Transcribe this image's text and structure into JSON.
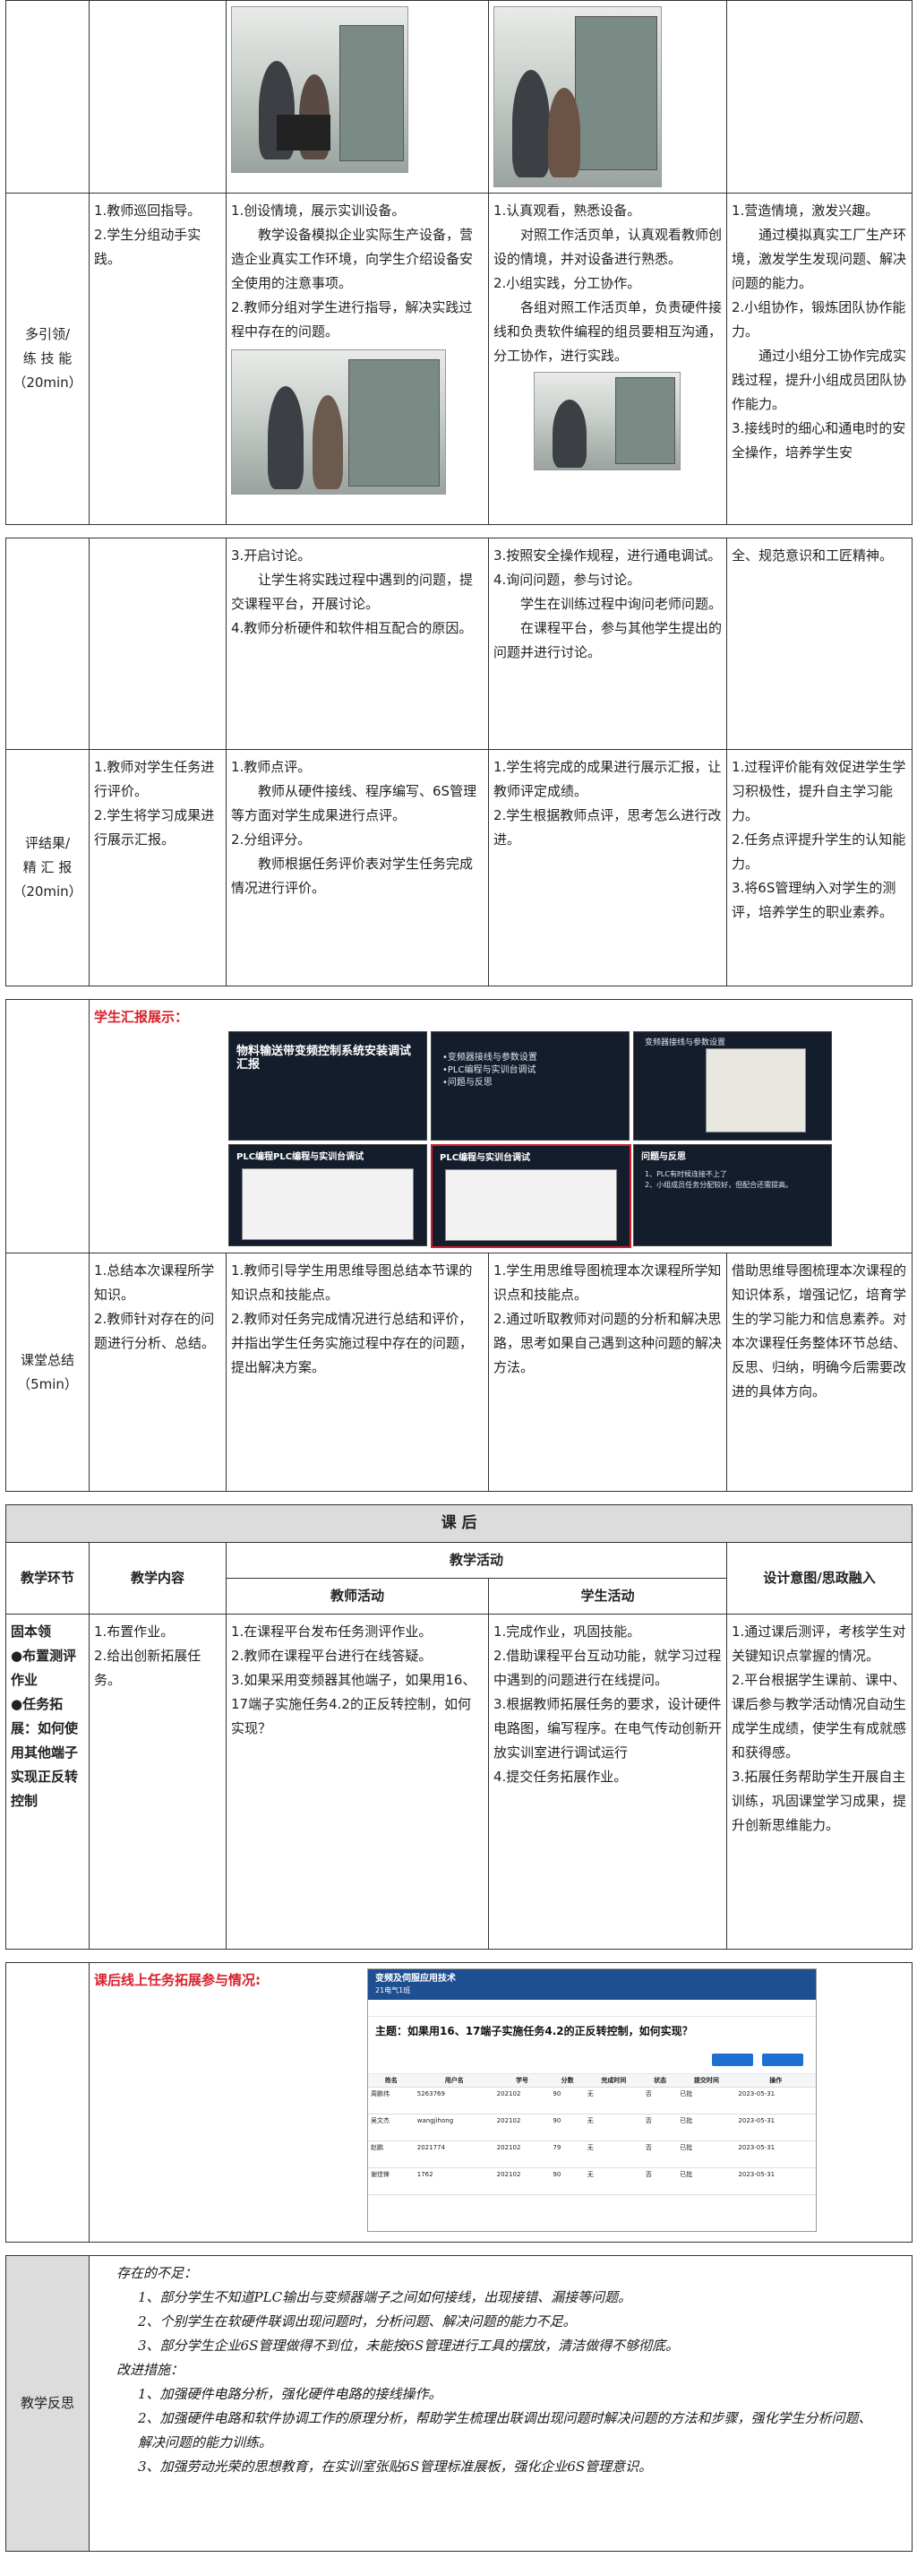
{
  "top_row": {
    "photos": [
      "photo-class-1",
      "photo-class-2"
    ]
  },
  "guide": {
    "label": "多引领/\n练 技 能\n（20min）",
    "content": [
      "1.教师巡回指导。",
      "2.学生分组动手实践。"
    ],
    "teacher": [
      "1.创设情境，展示实训设备。",
      "教学设备模拟企业实际生产设备，营造企业真实工作环境，向学生介绍设备安全使用的注意事项。",
      "2.教师分组对学生进行指导，解决实践过程中存在的问题。"
    ],
    "student": [
      "1.认真观看，熟悉设备。",
      "对照工作活页单，认真观看教师创设的情境，并对设备进行熟悉。",
      "2.小组实践，分工协作。",
      "各组对照工作活页单，负责硬件接线和负责软件编程的组员要相互沟通，分工协作，进行实践。"
    ],
    "design": [
      "1.营造情境，激发兴趣。",
      "通过模拟真实工厂生产环境，激发学生发现问题、解决问题的能力。",
      "2.小组协作，锻炼团队协作能力。",
      "通过小组分工协作完成实践过程，提升小组成员团队协作能力。",
      "3.接线时的细心和通电时的安全操作，培养学生安"
    ]
  },
  "guide2": {
    "teacher": [
      "3.开启讨论。",
      "让学生将实践过程中遇到的问题，提交课程平台，开展讨论。",
      "4.教师分析硬件和软件相互配合的原因。"
    ],
    "student": [
      "3.按照安全操作规程，进行通电调试。",
      "4.询问问题，参与讨论。",
      "学生在训练过程中询问老师问题。",
      "在课程平台，参与其他学生提出的问题并进行讨论。"
    ],
    "design": [
      "全、规范意识和工匠精神。"
    ]
  },
  "evaluate": {
    "label": "评结果/\n精 汇 报\n（20min）",
    "content": [
      "1.教师对学生任务进行评价。",
      "2.学生将学习成果进行展示汇报。"
    ],
    "teacher": [
      "1.教师点评。",
      "教师从硬件接线、程序编写、6S管理等方面对学生成果进行点评。",
      "2.分组评分。",
      "教师根据任务评价表对学生任务完成情况进行评价。"
    ],
    "student": [
      "1.学生将完成的成果进行展示汇报，让教师评定成绩。",
      "2.学生根据教师点评，思考怎么进行改进。"
    ],
    "design": [
      "1.过程评价能有效促进学生学习积极性，提升自主学习能力。",
      "2.任务点评提升学生的认知能力。",
      "3.将6S管理纳入对学生的测评，培养学生的职业素养。"
    ]
  },
  "showcase": {
    "heading": "学生汇报展示：",
    "slides": [
      {
        "title": "物料输送带变频控制系统安装调试汇报",
        "body": ""
      },
      {
        "title": "",
        "body": "•变频器接线与参数设置\n•PLC编程与实训台调试\n•问题与反思"
      },
      {
        "title": "",
        "body": "变频器接线与参数设置"
      },
      {
        "title": "PLC编程PLC编程与实训台调试",
        "body": ""
      },
      {
        "title": "PLC编程与实训台调试",
        "body": ""
      },
      {
        "title": "问题与反思",
        "body": "1、PLC有时候连接不上了\n2、小组成员任务分配较好，但配合还需提高。"
      }
    ]
  },
  "summary": {
    "label": "课堂总结\n（5min）",
    "content": [
      "1.总结本次课程所学知识。",
      "2.教师针对存在的问题进行分析、总结。"
    ],
    "teacher": [
      "1.教师引导学生用思维导图总结本节课的知识点和技能点。",
      "2.教师对任务完成情况进行总结和评价，并指出学生任务实施过程中存在的问题，提出解决方案。"
    ],
    "student": [
      "1.学生用思维导图梳理本次课程所学知识点和技能点。",
      "2.通过听取教师对问题的分析和解决思路，思考如果自己遇到这种问题的解决方法。"
    ],
    "design": [
      "借助思维导图梳理本次课程的知识体系，增强记忆，培育学生的学习能力和信息素养。对本次课程任务整体环节总结、反思、归纳，明确今后需要改进的具体方向。"
    ]
  },
  "after": {
    "title": "课 后",
    "headers": {
      "link": "教学环节",
      "content": "教学内容",
      "activity": "教学活动",
      "teacher": "教师活动",
      "student": "学生活动",
      "design": "设计意图/思政融入"
    },
    "label": [
      "固本领",
      "●布置测评作业",
      "●任务拓展：如何使用其他端子实现正反转控制"
    ],
    "content": [
      "1.布置作业。",
      "2.给出创新拓展任务。"
    ],
    "teacher": [
      "1.在课程平台发布任务测评作业。",
      "2.教师在课程平台进行在线答疑。",
      "3.如果采用变频器其他端子，如果用16、17端子实施任务4.2的正反转控制，如何实现？"
    ],
    "student": [
      "1.完成作业，巩固技能。",
      "2.借助课程平台互动功能，就学习过程中遇到的问题进行在线提问。",
      "3.根据教师拓展任务的要求，设计硬件电路图，编写程序。在电气传动创新开放实训室进行调试运行",
      "4.提交任务拓展作业。"
    ],
    "design": [
      "1.通过课后测评，考核学生对关键知识点掌握的情况。",
      "2.平台根据学生课前、课中、课后参与教学活动情况自动生成学生成绩，使学生有成就感和获得感。",
      "3.拓展任务帮助学生开展自主训练，巩固课堂学习成果，提升创新思维能力。"
    ]
  },
  "online": {
    "heading": "课后线上任务拓展参与情况:",
    "site": "变频及伺服应用技术",
    "site_sub": "21电气1班",
    "topic": "主题：如果用16、17端子实施任务4.2的正反转控制，如何实现？",
    "cols": [
      "姓名",
      "用户名",
      "学号",
      "分数",
      "完成时间",
      "状态",
      "提交时间",
      "操作"
    ],
    "rows": [
      [
        "周鹏伟",
        "5263769",
        "202102",
        "90",
        "无",
        "否",
        "已批",
        "2023-05-31"
      ],
      [
        "吴文杰",
        "wangjihong",
        "202102",
        "90",
        "无",
        "否",
        "已批",
        "2023-05-31"
      ],
      [
        "赵鹏",
        "2021774",
        "202102",
        "79",
        "无",
        "否",
        "已批",
        "2023-05-31"
      ],
      [
        "谢佳锋",
        "1762",
        "202102",
        "90",
        "无",
        "否",
        "已批",
        "2023-05-31"
      ]
    ]
  },
  "reflection": {
    "label": "教学反思",
    "lines": [
      "存在的不足：",
      "1、部分学生不知道PLC输出与变频器端子之间如何接线，出现接错、漏接等问题。",
      "2、个别学生在软硬件联调出现问题时，分析问题、解决问题的能力不足。",
      "3、部分学生企业6S管理做得不到位，未能按6S管理进行工具的摆放，清洁做得不够彻底。",
      "改进措施：",
      "1、加强硬件电路分析，强化硬件电路的接线操作。",
      "2、加强硬件电路和软件协调工作的原理分析，帮助学生梳理出联调出现问题时解决问题的方法和步骤，强化学生分析问题、解决问题的能力训练。",
      "3、加强劳动光荣的思想教育，在实训室张贴6S管理标准展板，强化企业6S管理意识。"
    ]
  }
}
